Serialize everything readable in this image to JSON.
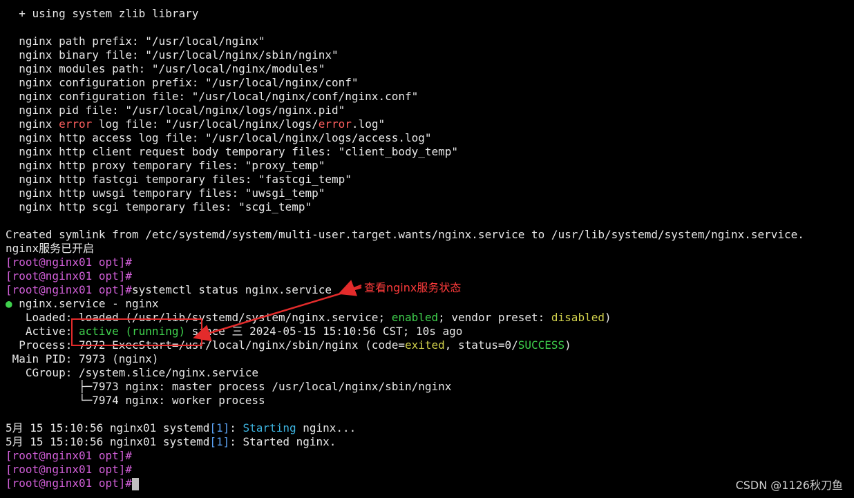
{
  "build_summary": {
    "zlib_line": "  + using system zlib library",
    "paths": [
      "  nginx path prefix: \"/usr/local/nginx\"",
      "  nginx binary file: \"/usr/local/nginx/sbin/nginx\"",
      "  nginx modules path: \"/usr/local/nginx/modules\"",
      "  nginx configuration prefix: \"/usr/local/nginx/conf\"",
      "  nginx configuration file: \"/usr/local/nginx/conf/nginx.conf\"",
      "  nginx pid file: \"/usr/local/nginx/logs/nginx.pid\""
    ],
    "error_log": {
      "p1": "  nginx ",
      "err1": "error",
      "p2": " log file: \"/usr/local/nginx/logs/",
      "err2": "error",
      "p3": ".log\""
    },
    "paths2": [
      "  nginx http access log file: \"/usr/local/nginx/logs/access.log\"",
      "  nginx http client request body temporary files: \"client_body_temp\"",
      "  nginx http proxy temporary files: \"proxy_temp\"",
      "  nginx http fastcgi temporary files: \"fastcgi_temp\"",
      "  nginx http uwsgi temporary files: \"uwsgi_temp\"",
      "  nginx http scgi temporary files: \"scgi_temp\""
    ]
  },
  "symlink_line": "Created symlink from /etc/systemd/system/multi-user.target.wants/nginx.service to /usr/lib/systemd/system/nginx.service.",
  "service_started_msg": "nginx服务已开启",
  "prompt": "[root@nginx01 opt]#",
  "command": "systemctl status nginx.service",
  "status": {
    "bullet": "●",
    "title": " nginx.service - nginx",
    "loaded_prefix": "   Loaded: loaded (/usr/lib/systemd/system/nginx.service; ",
    "loaded_enabled": "enabled",
    "loaded_mid": "; vendor preset: ",
    "loaded_disabled": "disabled",
    "loaded_suffix": ")",
    "active_prefix": "   Active: ",
    "active_state": "active (running)",
    "active_suffix": " since 三 2024-05-15 15:10:56 CST; 10s ago",
    "process_prefix": "  Process: 7972 ExecStart=/usr/local/nginx/sbin/nginx (code=",
    "process_exited": "exited",
    "process_mid": ", status=0/",
    "process_success": "SUCCESS",
    "process_suffix": ")",
    "main_pid": " Main PID: 7973 (nginx)",
    "cgroup": "   CGroup: /system.slice/nginx.service",
    "cgroup_master": "           ├─7973 nginx: master process /usr/local/nginx/sbin/nginx",
    "cgroup_worker": "           └─7974 nginx: worker process"
  },
  "journal": {
    "line1_prefix": "5月 15 15:10:56 nginx01 systemd",
    "pid": "[1]",
    "line1_colon": ": ",
    "line1_verb": "Starting",
    "line1_rest": " nginx...",
    "line2_prefix": "5月 15 15:10:56 nginx01 systemd",
    "line2_rest": ": Started nginx."
  },
  "annotation": {
    "text": "查看nginx服务状态"
  },
  "watermark": "CSDN @1126秋刀鱼",
  "colors": {
    "background": "#000000",
    "prompt": "#d15fd8",
    "error": "#ff5f5f",
    "ok": "#3fd14d",
    "warn": "#d2d24c",
    "info": "#3db4e0",
    "annotation": "#e32b2b"
  }
}
